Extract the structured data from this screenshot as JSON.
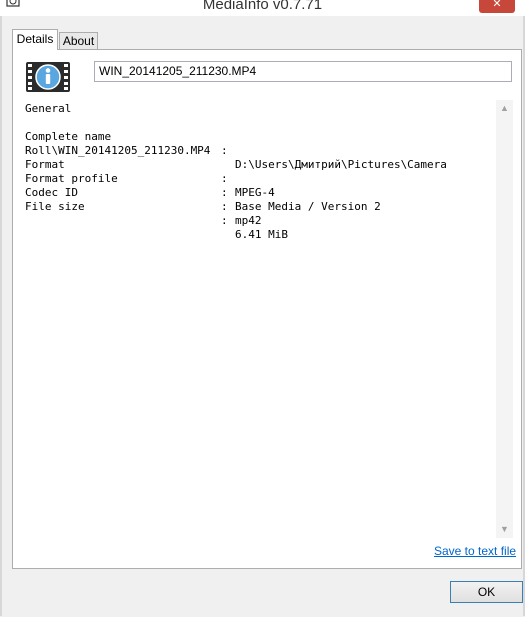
{
  "window": {
    "title": "MediaInfo v0.7.71",
    "close_glyph": "✕"
  },
  "tabs": [
    {
      "label": "Details",
      "selected": true
    },
    {
      "label": "About",
      "selected": false
    }
  ],
  "filename": "WIN_20141205_211230.MP4",
  "info": {
    "section": "General",
    "rows": [
      {
        "key": "Complete name",
        "sep": ":",
        "value": "D:\\Users\\Дмитрий\\Pictures\\Camera"
      },
      {
        "key": "Roll\\WIN_20141205_211230.MP4",
        "sep": "",
        "value": ""
      },
      {
        "key": "Format",
        "sep": ":",
        "value": "MPEG-4"
      },
      {
        "key": "Format profile",
        "sep": ":",
        "value": "Base Media / Version 2"
      },
      {
        "key": "Codec ID",
        "sep": ":",
        "value": "mp42"
      },
      {
        "key": "File size",
        "sep": ":",
        "value": "6.41 MiB"
      }
    ]
  },
  "scroll": {
    "up_glyph": "▲",
    "down_glyph": "▼"
  },
  "save_link": "Save to text file",
  "ok_button": "OK",
  "colors": {
    "accent_link": "#0066cc",
    "close_button": "#c7473a"
  }
}
